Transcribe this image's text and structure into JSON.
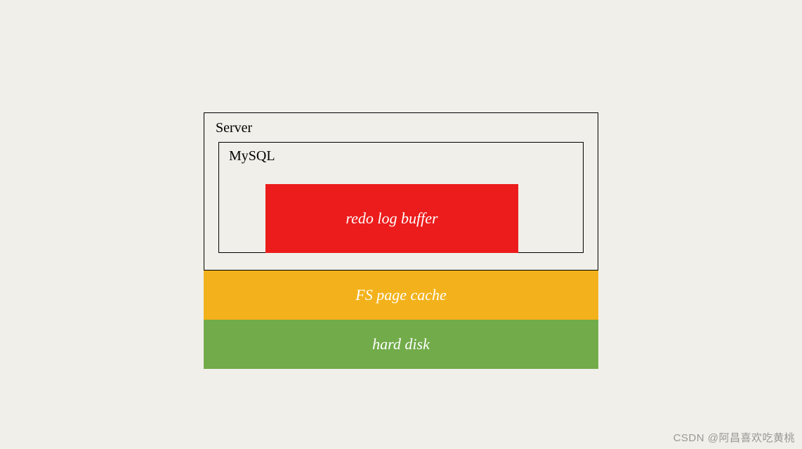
{
  "diagram": {
    "server_label": "Server",
    "mysql_label": "MySQL",
    "redo_label": "redo log buffer",
    "fs_label": "FS page cache",
    "disk_label": "hard disk"
  },
  "watermark": "CSDN @阿昌喜欢吃黄桃",
  "colors": {
    "background": "#f0efe9",
    "redo": "#ec1c1c",
    "fs": "#f3b21b",
    "disk": "#72ab4a",
    "border": "#000000",
    "text_light": "#ffffff"
  }
}
